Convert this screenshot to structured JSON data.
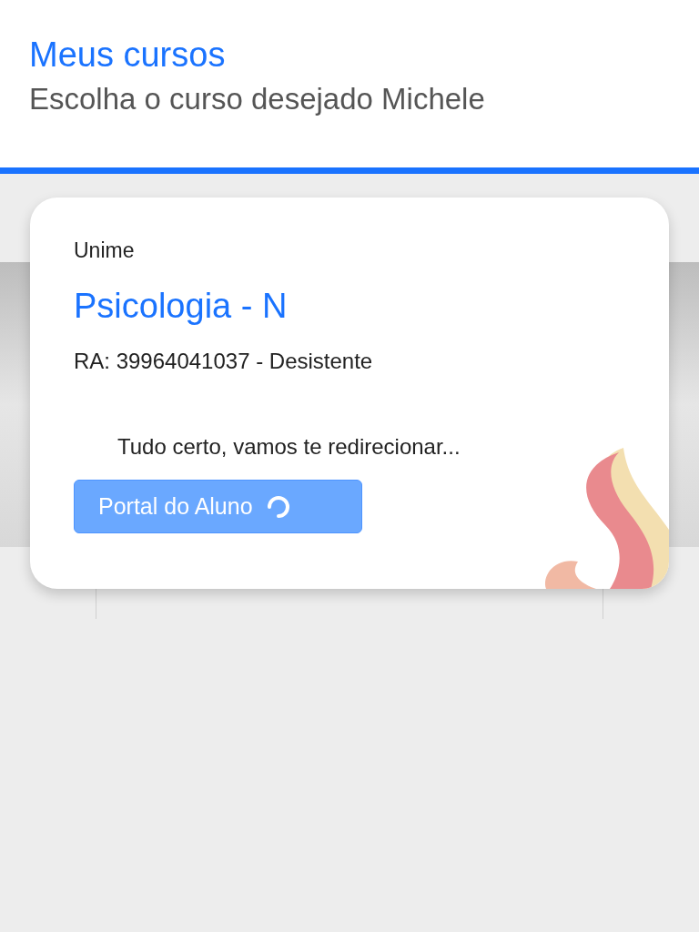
{
  "header": {
    "title": "Meus cursos",
    "subtitle": "Escolha o curso desejado Michele"
  },
  "course": {
    "institution": "Unime",
    "name": "Psicologia - N",
    "ra": "RA: 39964041037 - Desistente",
    "message": "Tudo certo, vamos te redirecionar...",
    "button": {
      "label": "Portal do Aluno",
      "loading": true
    }
  }
}
